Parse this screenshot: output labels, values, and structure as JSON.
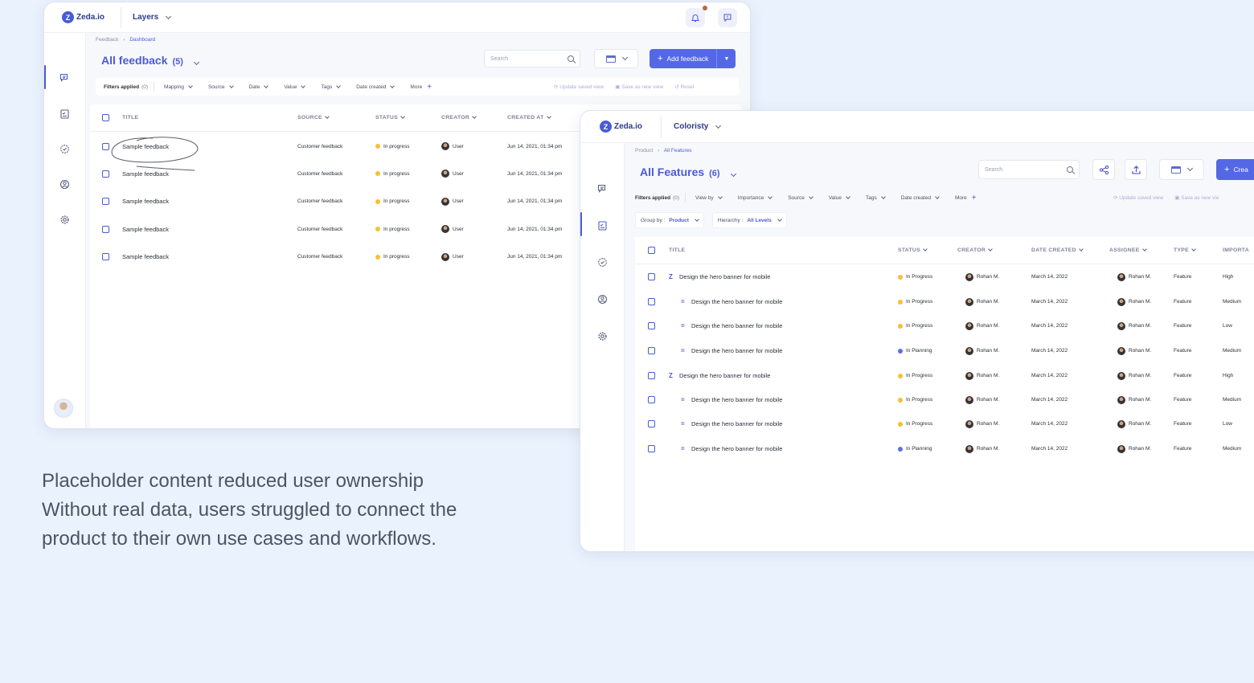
{
  "win1": {
    "brand": "Zeda.io",
    "project": "Layers",
    "breadcrumb": {
      "parent": "Feedback",
      "current": "Dashboard"
    },
    "title": "All feedback",
    "count": "(5)",
    "search_placeholder": "Search",
    "add_label": "Add feedback",
    "filters": {
      "applied_label": "Filters applied",
      "applied_count": "(0)",
      "items": [
        "Mapping",
        "Source",
        "Date",
        "Value",
        "Tags",
        "Date created"
      ],
      "more": "More"
    },
    "actions": {
      "update": "Update saved view",
      "save": "Save as new view",
      "reset": "Reset"
    },
    "columns": {
      "title": "TITLE",
      "source": "SOURCE",
      "status": "STATUS",
      "creator": "CREATOR",
      "created_at": "CREATED AT"
    },
    "rows": [
      {
        "title": "Sample feedback",
        "source": "Customer feedback",
        "status": "In progress",
        "creator": "User",
        "created": "Jun 14, 2021, 01:34 pm"
      },
      {
        "title": "Sample feedback",
        "source": "Customer feedback",
        "status": "In progress",
        "creator": "User",
        "created": "Jun 14, 2021, 01:34 pm"
      },
      {
        "title": "Sample feedback",
        "source": "Customer feedback",
        "status": "In progress",
        "creator": "User",
        "created": "Jun 14, 2021, 01:34 pm"
      },
      {
        "title": "Sample feedback",
        "source": "Customer feedback",
        "status": "In progress",
        "creator": "User",
        "created": "Jun 14, 2021, 01:34 pm"
      },
      {
        "title": "Sample feedback",
        "source": "Customer feedback",
        "status": "In progress",
        "creator": "User",
        "created": "Jun 14, 2021, 01:34 pm"
      }
    ]
  },
  "win2": {
    "brand": "Zeda.io",
    "project": "Coloristy",
    "breadcrumb": {
      "parent": "Product",
      "current": "All Features"
    },
    "title": "All Features",
    "count": "(6)",
    "search_placeholder": "Search",
    "add_label": "Crea",
    "filters": {
      "applied_label": "Filters applied",
      "applied_count": "(0)",
      "items": [
        "View by",
        "Importance",
        "Source",
        "Value",
        "Tags",
        "Date created"
      ],
      "more": "More"
    },
    "actions": {
      "update": "Update saved view",
      "save": "Save as new vie"
    },
    "group_by": {
      "label": "Group by :",
      "value": "Product"
    },
    "hierarchy": {
      "label": "Hierarchy :",
      "value": "All Levels"
    },
    "columns": {
      "title": "TITLE",
      "status": "STATUS",
      "creator": "CREATOR",
      "date_created": "DATE CREATED",
      "assignee": "ASSIGNEE",
      "type": "TYPE",
      "importance": "IMPORTA"
    },
    "rows": [
      {
        "title": "Design the hero banner for mobile",
        "level": "parent",
        "status": "In Progress",
        "creator": "Rohan M.",
        "date": "March 14, 2022",
        "assignee": "Rohan M.",
        "type": "Feature",
        "importance": "High"
      },
      {
        "title": "Design the hero banner for mobile",
        "level": "child",
        "status": "In Progress",
        "creator": "Rohan M.",
        "date": "March 14, 2022",
        "assignee": "Rohan M.",
        "type": "Feature",
        "importance": "Medium"
      },
      {
        "title": "Design the hero banner for mobile",
        "level": "child",
        "status": "In Progress",
        "creator": "Rohan M.",
        "date": "March 14, 2022",
        "assignee": "Rohan M.",
        "type": "Feature",
        "importance": "Low"
      },
      {
        "title": "Design the hero banner for mobile",
        "level": "child",
        "status": "In Planning",
        "creator": "Rohan M.",
        "date": "March 14, 2022",
        "assignee": "Rohan M.",
        "type": "Feature",
        "importance": "Medium"
      },
      {
        "title": "Design the hero banner for mobile",
        "level": "parent",
        "status": "In Progress",
        "creator": "Rohan M.",
        "date": "March 14, 2022",
        "assignee": "Rohan M.",
        "type": "Feature",
        "importance": "High"
      },
      {
        "title": "Design the hero banner for mobile",
        "level": "child",
        "status": "In Progress",
        "creator": "Rohan M.",
        "date": "March 14, 2022",
        "assignee": "Rohan M.",
        "type": "Feature",
        "importance": "Medium"
      },
      {
        "title": "Design the hero banner for mobile",
        "level": "child",
        "status": "In Progress",
        "creator": "Rohan M.",
        "date": "March 14, 2022",
        "assignee": "Rohan M.",
        "type": "Feature",
        "importance": "Low"
      },
      {
        "title": "Design the hero banner for mobile",
        "level": "child",
        "status": "In Planning",
        "creator": "Rohan M.",
        "date": "March 14, 2022",
        "assignee": "Rohan M.",
        "type": "Feature",
        "importance": "Medium"
      }
    ]
  },
  "caption": {
    "line1": "Placeholder content reduced user ownership",
    "line2": "Without real data, users struggled to connect the",
    "line3": "product to their own use cases and workflows."
  },
  "colors": {
    "accent": "#4a5bd6",
    "in_progress": "#f6c030",
    "in_planning": "#5b6fe3",
    "background": "#eaf2fd"
  },
  "icons": [
    "zeda-logo-icon",
    "bell-icon",
    "feedback-chat-icon",
    "roadmap-icon",
    "settings-gear-icon",
    "share-icon",
    "upload-icon",
    "table-view-icon"
  ]
}
